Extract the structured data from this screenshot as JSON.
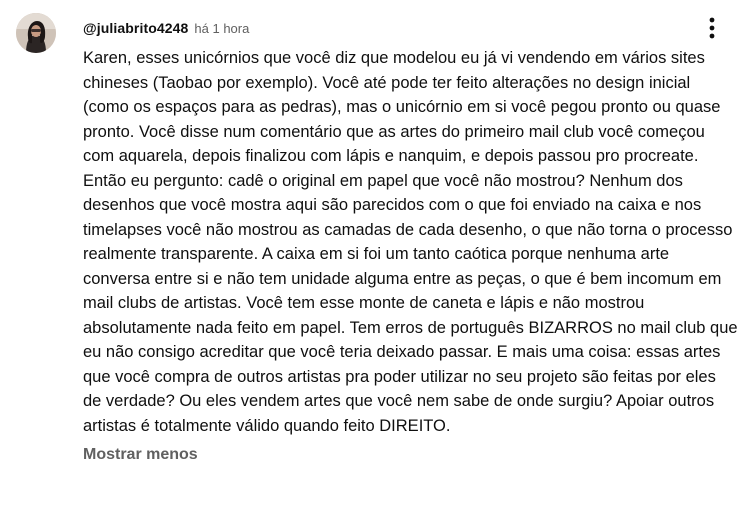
{
  "comment": {
    "author": "@juliabrito4248",
    "timestamp": "há 1 hora",
    "text": "Karen, esses unicórnios que você diz que modelou eu já vi vendendo em vários sites chineses (Taobao por exemplo). Você até pode ter feito alterações no design inicial (como os espaços para as pedras), mas o unicórnio em si você pegou pronto ou quase pronto. Você disse num comentário que as artes do primeiro mail club você começou com aquarela, depois finalizou com lápis e nanquim, e depois passou pro procreate. Então eu pergunto: cadê o original em papel que você não mostrou? Nenhum dos desenhos que você mostra aqui são parecidos com o que foi enviado na caixa e nos timelapses você não mostrou as camadas de cada desenho, o que não torna o processo realmente transparente. A caixa em si foi um tanto caótica porque nenhuma arte conversa entre si e não tem unidade alguma entre as peças, o que é bem incomum em mail clubs de artistas. Você tem esse monte de caneta e lápis e não mostrou absolutamente nada feito em papel. Tem erros de português BIZARROS no mail club que eu não consigo acreditar que você teria deixado passar. E mais uma coisa: essas artes que você compra de outros artistas pra poder utilizar no seu projeto são feitas por eles de verdade? Ou eles vendem artes que você nem sabe de onde surgiu? Apoiar outros artistas é totalmente válido quando feito DIREITO.",
    "show_less_label": "Mostrar menos",
    "icons": {
      "menu": "more-vertical-icon",
      "avatar": "avatar"
    },
    "colors": {
      "text": "#0f0f0f",
      "secondary": "#606060",
      "background": "#ffffff"
    }
  }
}
